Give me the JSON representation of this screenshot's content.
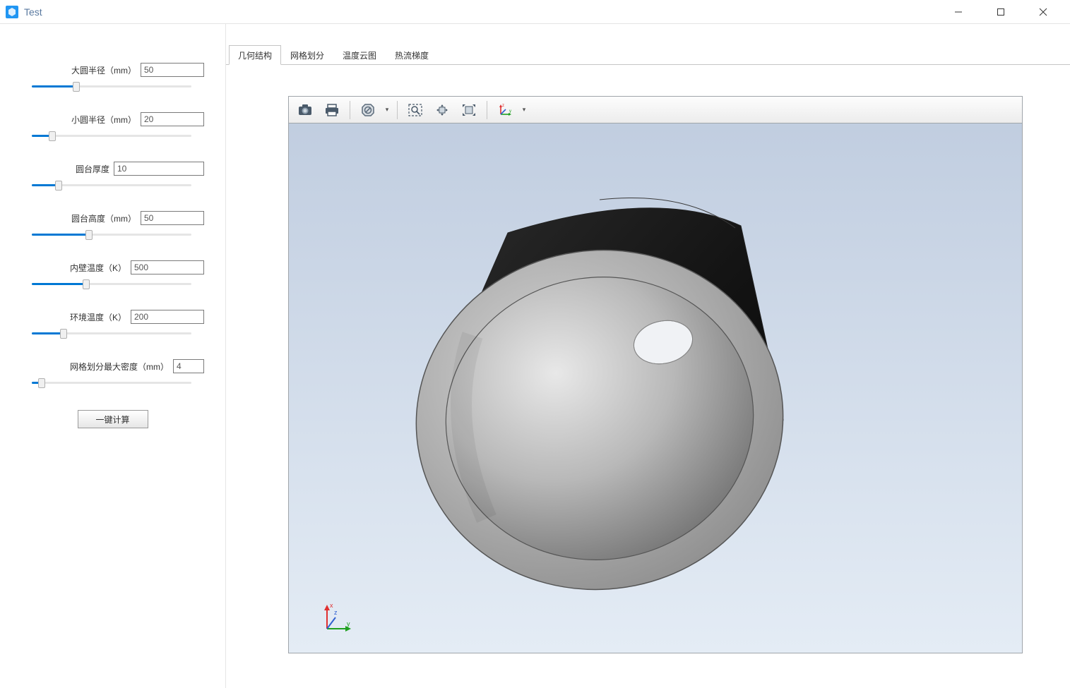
{
  "window": {
    "title": "Test"
  },
  "sidebar": {
    "params": [
      {
        "label": "大圆半径（mm）",
        "value": "50",
        "pos": 28
      },
      {
        "label": "小圆半径（mm）",
        "value": "20",
        "pos": 13
      },
      {
        "label": "圆台厚度",
        "value": "10",
        "pos": 17
      },
      {
        "label": "圆台高度（mm）",
        "value": "50",
        "pos": 36
      },
      {
        "label": "内壁温度（K）",
        "value": "500",
        "pos": 34
      },
      {
        "label": "环境温度（K）",
        "value": "200",
        "pos": 20
      },
      {
        "label": "网格划分最大密度（mm）",
        "value": "4",
        "pos": 6,
        "narrow": true
      }
    ],
    "calc_button": "一键计算"
  },
  "tabs": [
    "几何结构",
    "网格划分",
    "温度云图",
    "热流梯度"
  ],
  "active_tab": 0,
  "toolbar_icons": {
    "camera": "camera-icon",
    "print": "print-icon",
    "forbidden": "forbid-icon",
    "zoom_rect": "zoom-rect-icon",
    "pan": "pan-icon",
    "fit": "fit-icon",
    "axes": "axes-icon"
  }
}
